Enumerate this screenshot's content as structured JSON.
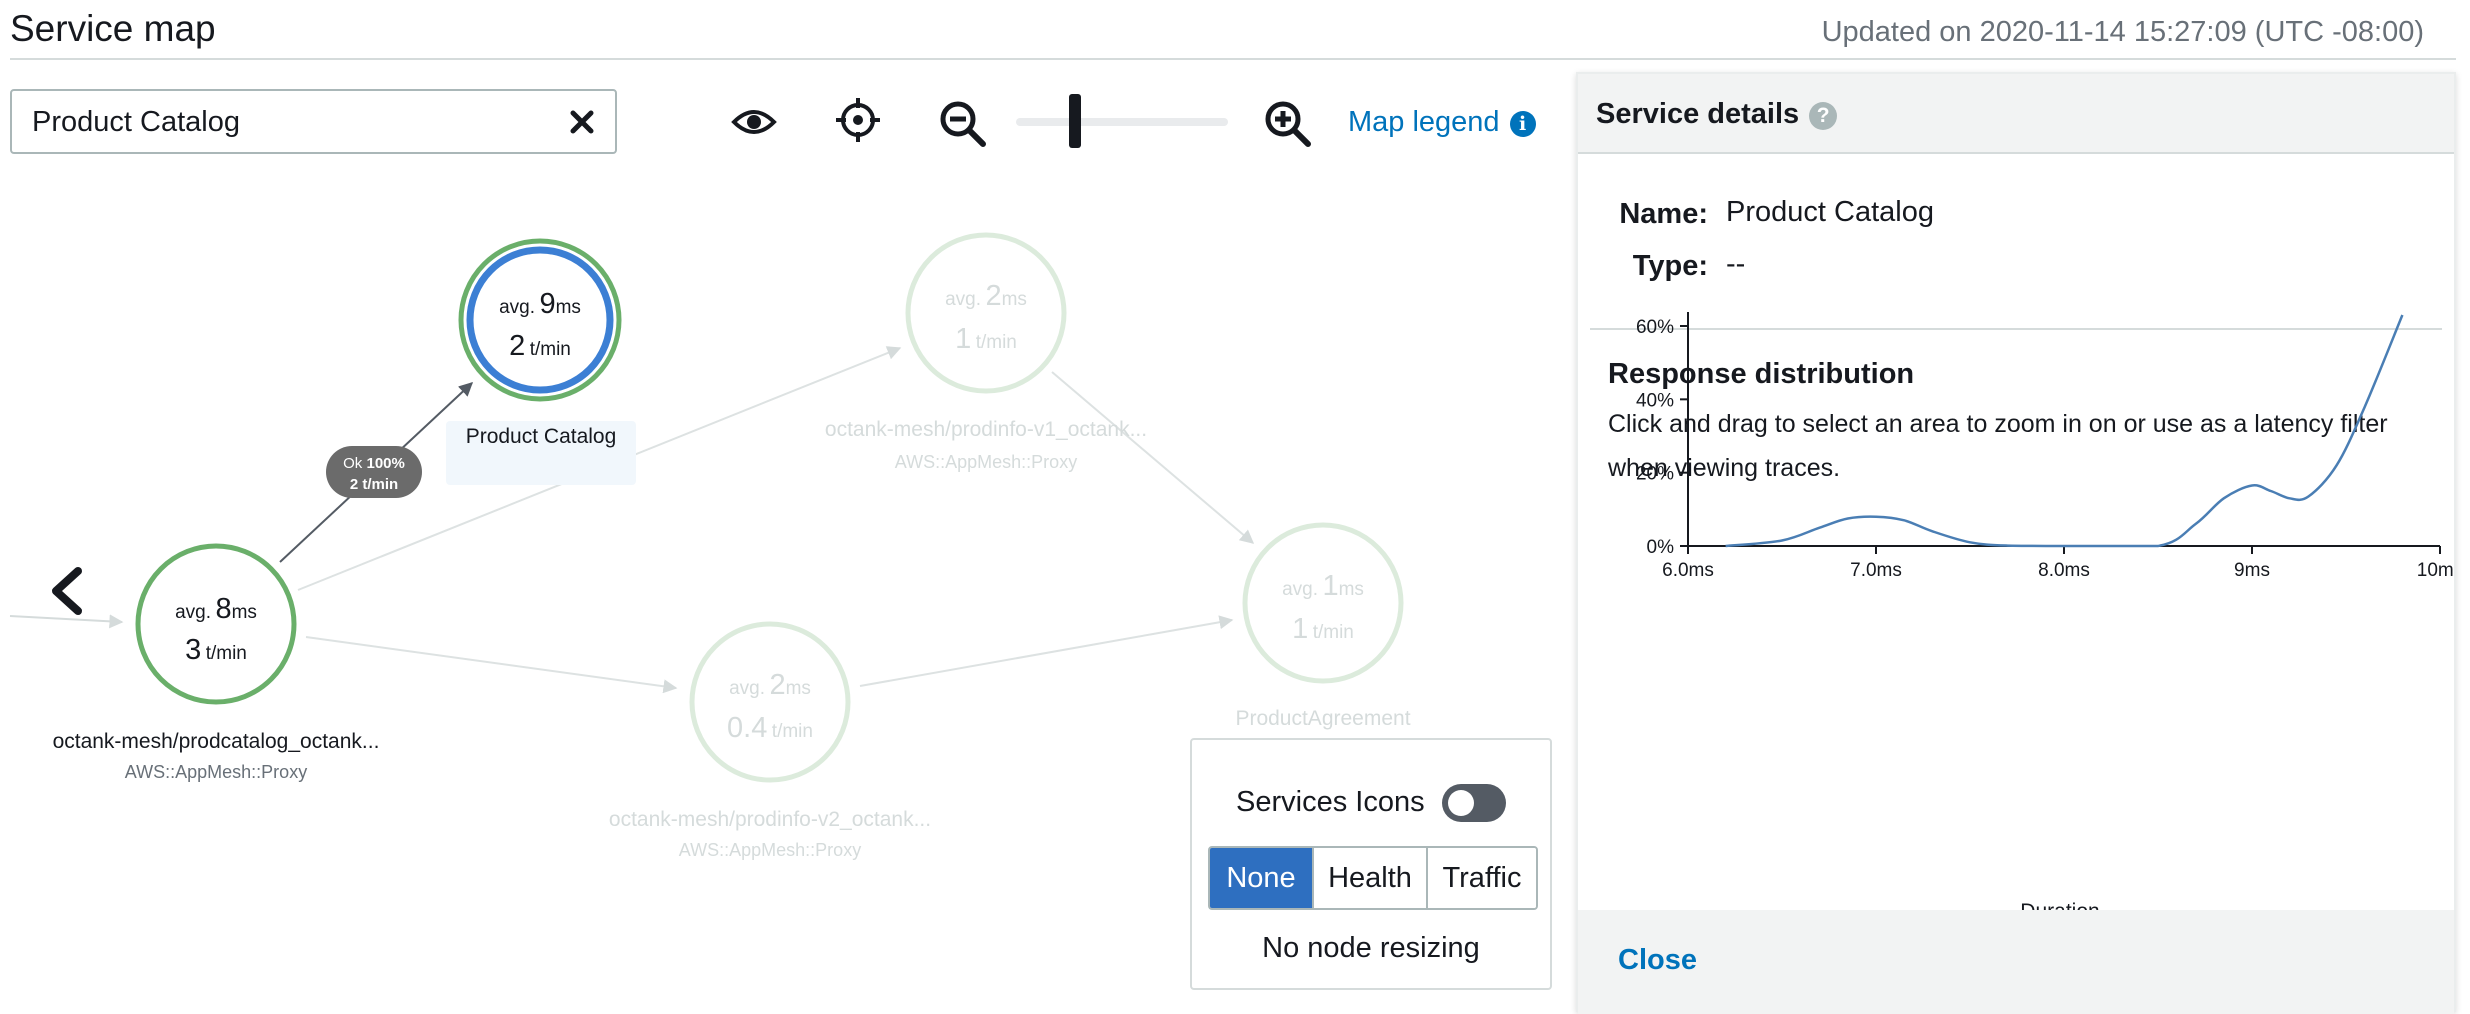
{
  "header": {
    "title": "Service map",
    "updated": "Updated on 2020-11-14 15:27:09 (UTC -08:00)"
  },
  "search": {
    "value": "Product Catalog"
  },
  "toolbar": {
    "map_legend": "Map legend",
    "zoom_level": 0.28
  },
  "edge_badge": {
    "status": "Ok",
    "percent": "100%",
    "rate": "2 t/min"
  },
  "nodes": [
    {
      "avg_prefix": "avg.",
      "avg": "9",
      "avg_unit": "ms",
      "tpm": "2",
      "tpm_unit": "t/min",
      "name": "Product Catalog",
      "type": ""
    },
    {
      "avg_prefix": "avg.",
      "avg": "8",
      "avg_unit": "ms",
      "tpm": "3",
      "tpm_unit": "t/min",
      "name": "octank-mesh/prodcatalog_octank...",
      "type": "AWS::AppMesh::Proxy"
    },
    {
      "avg_prefix": "avg.",
      "avg": "2",
      "avg_unit": "ms",
      "tpm": "1",
      "tpm_unit": "t/min",
      "name": "octank-mesh/prodinfo-v1_octank...",
      "type": "AWS::AppMesh::Proxy"
    },
    {
      "avg_prefix": "avg.",
      "avg": "2",
      "avg_unit": "ms",
      "tpm": "0.4",
      "tpm_unit": "t/min",
      "name": "octank-mesh/prodinfo-v2_octank...",
      "type": "AWS::AppMesh::Proxy"
    },
    {
      "avg_prefix": "avg.",
      "avg": "1",
      "avg_unit": "ms",
      "tpm": "1",
      "tpm_unit": "t/min",
      "name": "ProductAgreement",
      "type": ""
    }
  ],
  "controls": {
    "services_icons_label": "Services Icons",
    "services_icons_on": false,
    "resize_options": [
      "None",
      "Health",
      "Traffic"
    ],
    "selected_resize": "None",
    "resize_text": "No node resizing"
  },
  "details": {
    "title": "Service details",
    "help": "?",
    "name_label": "Name:",
    "name_value": "Product Catalog",
    "type_label": "Type:",
    "type_value": "--",
    "distribution_title": "Response distribution",
    "distribution_desc": "Click and drag to select an area to zoom in on or use as a latency filter when viewing traces.",
    "close": "Close"
  },
  "chart_data": {
    "type": "line",
    "title": "",
    "xlabel": "Duration",
    "ylabel": "",
    "x_ticks": [
      "6.0ms",
      "7.0ms",
      "8.0ms",
      "9ms",
      "10ms"
    ],
    "y_ticks": [
      "0%",
      "20%",
      "40%",
      "60%"
    ],
    "xlim": [
      6.0,
      10.0
    ],
    "ylim": [
      0,
      60
    ],
    "series": [
      {
        "color": "#4a7eb4",
        "x": [
          6.2,
          6.5,
          6.7,
          6.85,
          7.0,
          7.15,
          7.3,
          7.5,
          7.7,
          8.0,
          8.5,
          8.7,
          8.85,
          9.0,
          9.1,
          9.2,
          9.3,
          9.45,
          9.6,
          9.8
        ],
        "y": [
          0,
          1.5,
          5,
          7.5,
          8,
          7,
          4,
          1,
          0.1,
          0,
          0,
          6,
          13,
          16.5,
          15,
          13,
          13.5,
          22,
          38,
          63
        ]
      }
    ],
    "grid": false,
    "legend": "none"
  }
}
